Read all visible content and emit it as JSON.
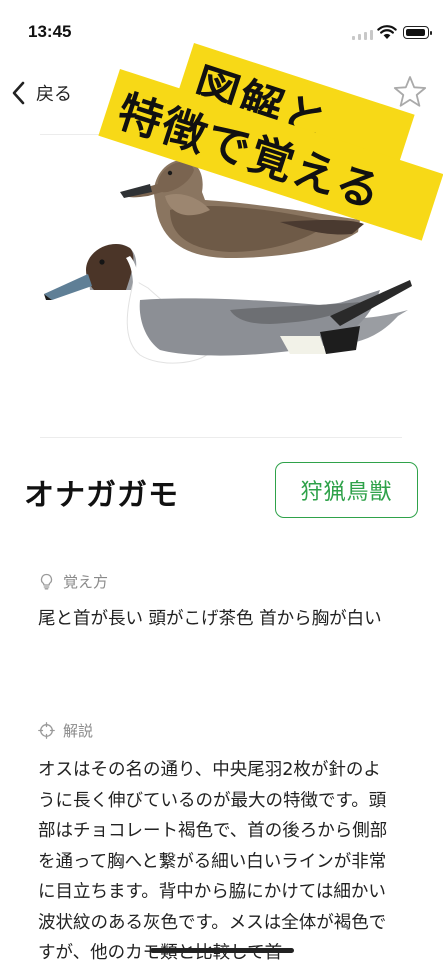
{
  "status_bar": {
    "time": "13:45"
  },
  "nav": {
    "back_label": "戻る"
  },
  "banner": {
    "line1": "図解と",
    "line2": "特徴で覚える"
  },
  "species": {
    "name": "オナガガモ",
    "badge": "狩猟鳥獣"
  },
  "memorize": {
    "label": "覚え方",
    "icon": "lightbulb-icon",
    "text": "尾と首が長い 頭がこげ茶色 首から胸が白い"
  },
  "description": {
    "label": "解説",
    "icon": "crosshair-icon",
    "text": "オスはその名の通り、中央尾羽2枚が針のように長く伸びているのが最大の特徴です。頭部はチョコレート褐色で、首の後ろから側部を通って胸へと繋がる細い白いラインが非常に目立ちます。背中から脇にかけては細かい波状紋のある灰色です。メスは全体が褐色ですが、他のカモ類と比較して首"
  },
  "colors": {
    "accent_green": "#2fa24a",
    "banner_yellow": "#f7d917"
  }
}
